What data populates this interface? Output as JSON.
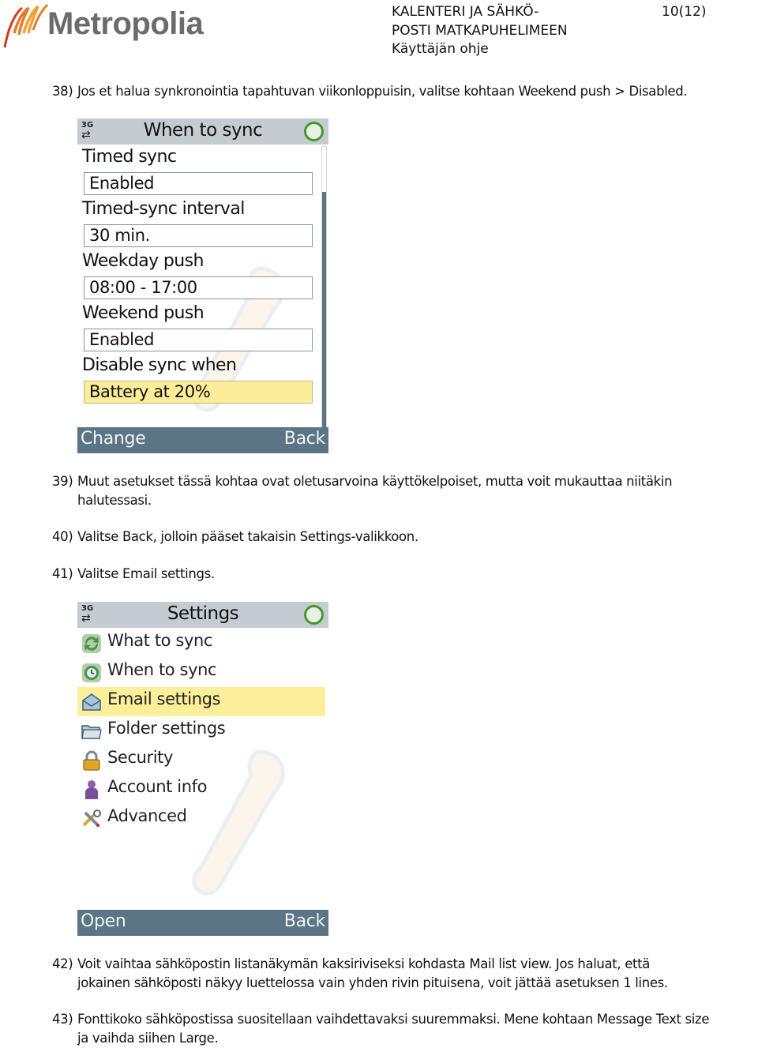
{
  "header": {
    "logo_text": "Metropolia",
    "doc_title_lines": [
      "KALENTERI JA SÄHKÖ-",
      "POSTI MATKAPUHELIMEEN",
      "Käyttäjän ohje"
    ],
    "page_number": "10(12)"
  },
  "steps": [
    {
      "num": "38)",
      "lines": [
        "Jos et halua synkronointia tapahtuvan viikonloppuisin, valitse kohtaan Weekend push > Disabled."
      ]
    },
    {
      "num": "39)",
      "lines": [
        "Muut asetukset tässä kohtaa ovat oletusarvoina käyttökelpoiset, mutta voit mukauttaa niitäkin",
        "halutessasi."
      ]
    },
    {
      "num": "40)",
      "lines": [
        "Valitse Back, jolloin pääset takaisin Settings-valikkoon."
      ]
    },
    {
      "num": "41)",
      "lines": [
        "Valitse Email settings."
      ]
    },
    {
      "num": "42)",
      "lines": [
        "Voit vaihtaa sähköpostin listanäkymän kaksiriviseksi kohdasta Mail list view. Jos haluat, että",
        "jokainen sähköposti näkyy luettelossa vain yhden rivin pituisena, voit jättää asetuksen 1 lines."
      ]
    },
    {
      "num": "43)",
      "lines": [
        "Fonttikoko sähköpostissa suositellaan vaihdettavaksi suuremmaksi. Mene kohtaan Message Text size",
        "ja vaihda siihen Large."
      ]
    }
  ],
  "screen1": {
    "network": "3G",
    "title": "When to sync",
    "settings": [
      {
        "label": "Timed sync",
        "value": "Enabled",
        "selected": false
      },
      {
        "label": "Timed-sync interval",
        "value": "30 min.",
        "selected": false
      },
      {
        "label": "Weekday push",
        "value": "08:00 - 17:00",
        "selected": false
      },
      {
        "label": "Weekend push",
        "value": "Enabled",
        "selected": false
      },
      {
        "label": "Disable sync when",
        "value": "Battery at 20%",
        "selected": true
      }
    ],
    "left_softkey": "Change",
    "right_softkey": "Back",
    "scroll_position": 0.0,
    "scroll_visible_fraction": 0.16
  },
  "screen2": {
    "network": "3G",
    "title": "Settings",
    "items": [
      {
        "label": "What to sync",
        "icon": "sync-arrows-icon",
        "selected": false
      },
      {
        "label": "When to sync",
        "icon": "sync-clock-icon",
        "selected": false
      },
      {
        "label": "Email settings",
        "icon": "envelope-icon",
        "selected": true
      },
      {
        "label": "Folder settings",
        "icon": "folder-icon",
        "selected": false
      },
      {
        "label": "Security",
        "icon": "padlock-icon",
        "selected": false
      },
      {
        "label": "Account info",
        "icon": "person-icon",
        "selected": false
      },
      {
        "label": "Advanced",
        "icon": "tools-icon",
        "selected": false
      }
    ],
    "left_softkey": "Open",
    "right_softkey": "Back"
  },
  "colors": {
    "titlebar": "#c4ccd2",
    "softkey_bar": "#5c7584",
    "selection": "#fcef9c",
    "status_ring": "#3f9a2a",
    "logo_gray": "#6b6b6b",
    "logo_orange": "#e8782a",
    "logo_red": "#d23a1f"
  }
}
